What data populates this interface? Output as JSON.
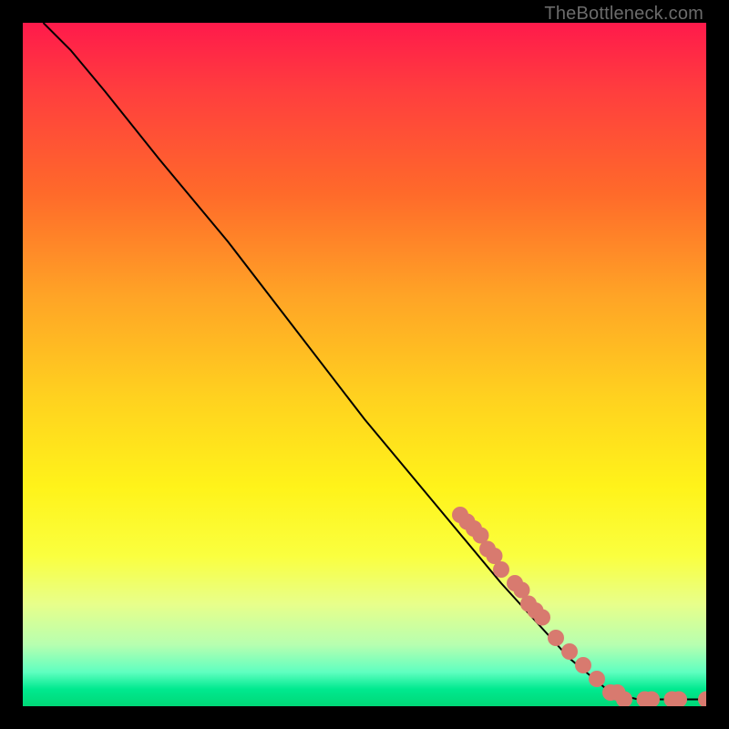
{
  "attribution": "TheBottleneck.com",
  "chart_data": {
    "type": "line",
    "title": "",
    "xlabel": "",
    "ylabel": "",
    "xlim": [
      0,
      100
    ],
    "ylim": [
      0,
      100
    ],
    "curve": [
      {
        "x": 3,
        "y": 100
      },
      {
        "x": 7,
        "y": 96
      },
      {
        "x": 12,
        "y": 90
      },
      {
        "x": 20,
        "y": 80
      },
      {
        "x": 30,
        "y": 68
      },
      {
        "x": 40,
        "y": 55
      },
      {
        "x": 50,
        "y": 42
      },
      {
        "x": 60,
        "y": 30
      },
      {
        "x": 70,
        "y": 18
      },
      {
        "x": 80,
        "y": 7
      },
      {
        "x": 86,
        "y": 2
      },
      {
        "x": 90,
        "y": 1
      },
      {
        "x": 100,
        "y": 1
      }
    ],
    "marker_clusters": [
      {
        "x": 64,
        "y": 28
      },
      {
        "x": 65,
        "y": 27
      },
      {
        "x": 66,
        "y": 26
      },
      {
        "x": 67,
        "y": 25
      },
      {
        "x": 68,
        "y": 23
      },
      {
        "x": 69,
        "y": 22
      },
      {
        "x": 70,
        "y": 20
      },
      {
        "x": 72,
        "y": 18
      },
      {
        "x": 73,
        "y": 17
      },
      {
        "x": 74,
        "y": 15
      },
      {
        "x": 75,
        "y": 14
      },
      {
        "x": 76,
        "y": 13
      },
      {
        "x": 78,
        "y": 10
      },
      {
        "x": 80,
        "y": 8
      },
      {
        "x": 82,
        "y": 6
      },
      {
        "x": 84,
        "y": 4
      },
      {
        "x": 86,
        "y": 2
      },
      {
        "x": 87,
        "y": 2
      },
      {
        "x": 88,
        "y": 1
      },
      {
        "x": 91,
        "y": 1
      },
      {
        "x": 92,
        "y": 1
      },
      {
        "x": 95,
        "y": 1
      },
      {
        "x": 96,
        "y": 1
      },
      {
        "x": 100,
        "y": 1
      }
    ],
    "marker_color": "#d87a6f",
    "line_color": "#000000"
  }
}
